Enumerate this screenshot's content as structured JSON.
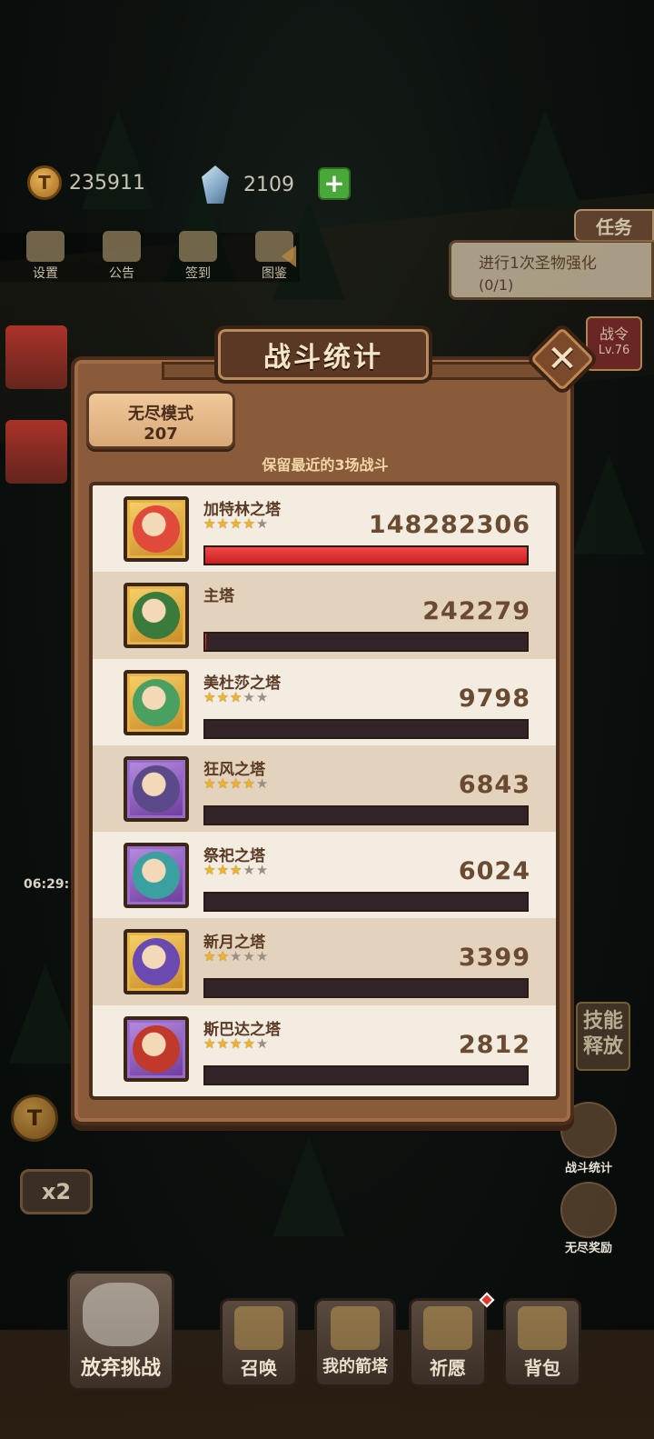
{
  "resources": {
    "coins": "235911",
    "gems": "2109",
    "plus": "+"
  },
  "top_menu": [
    {
      "label": "设置",
      "icon": "gear-icon"
    },
    {
      "label": "公告",
      "icon": "scroll-icon"
    },
    {
      "label": "签到",
      "icon": "quill-icon"
    },
    {
      "label": "图鉴",
      "icon": "book-icon"
    }
  ],
  "quest": {
    "tab": "任务",
    "text": "进行1次圣物强化",
    "progress": "(0/1)"
  },
  "battle_pass": {
    "label": "战令",
    "level": "Lv.76"
  },
  "side": {
    "stats_label": "战斗统计",
    "endless_reward_label": "无尽奖励",
    "skill_label": "技能释放",
    "speed": "x2",
    "timer": "06:29:"
  },
  "bottom_bar": {
    "give_up": "放弃挑战",
    "summon": "召唤",
    "my_towers": "我的箭塔",
    "pray": "祈愿",
    "bag": "背包"
  },
  "modal": {
    "title": "战斗统计",
    "close": "✕",
    "mode_name": "无尽模式",
    "mode_value": "207",
    "note": "保留最近的3场战斗",
    "rows": [
      {
        "name": "加特林之塔",
        "stars": 4,
        "damage": "148282306",
        "ratio": 1.0,
        "frame": "gold",
        "color": "#e04a3a"
      },
      {
        "name": "主塔",
        "stars": 0,
        "damage": "242279",
        "ratio": 0.0016,
        "frame": "gold",
        "color": "#3a7a3a"
      },
      {
        "name": "美杜莎之塔",
        "stars": 3,
        "damage": "9798",
        "ratio": 0.0001,
        "frame": "gold",
        "color": "#4aa060"
      },
      {
        "name": "狂风之塔",
        "stars": 4,
        "damage": "6843",
        "ratio": 5e-05,
        "frame": "purple",
        "color": "#5a4a8a"
      },
      {
        "name": "祭祀之塔",
        "stars": 3,
        "damage": "6024",
        "ratio": 4e-05,
        "frame": "purple",
        "color": "#3aa0a0"
      },
      {
        "name": "新月之塔",
        "stars": 2,
        "damage": "3399",
        "ratio": 2e-05,
        "frame": "gold",
        "color": "#6a4ab0"
      },
      {
        "name": "斯巴达之塔",
        "stars": 4,
        "damage": "2812",
        "ratio": 2e-05,
        "frame": "purple",
        "color": "#c0392b"
      }
    ]
  }
}
